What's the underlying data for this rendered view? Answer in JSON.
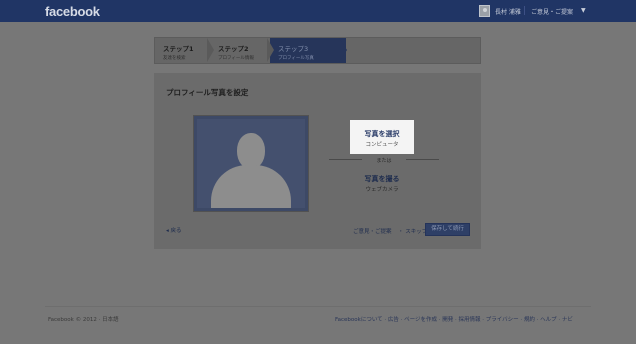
{
  "topbar": {
    "logo": "facebook",
    "user_name": "長村 浦雅",
    "feedback": "ご意見・ご提案",
    "caret": "▼"
  },
  "steps": [
    {
      "title": "ステップ1",
      "subtitle": "友達を検索"
    },
    {
      "title": "ステップ2",
      "subtitle": "プロフィール情報"
    },
    {
      "title": "ステップ3",
      "subtitle": "プロフィール写真"
    }
  ],
  "dialog": {
    "title": "プロフィール写真を設定",
    "choose_photo": "写真を選択",
    "choose_photo_sub": "コンピュータ",
    "or": "または",
    "take_photo": "写真を撮る",
    "take_photo_sub": "ウェブカメラ",
    "back": "◂ 戻る",
    "feedback": "ご意見・ご提案",
    "skip": "・ スキップ",
    "save": "保存して続行"
  },
  "footer": {
    "copyright": "Facebook © 2012 · 日本語",
    "links": "Facebookについて · 広告 · ページを作成 · 開発 · 採用情報 · プライバシー · 規約 · ヘルプ · ナビ"
  },
  "colors": {
    "topbar": "#203565",
    "overlay": "#777777",
    "active_step": "#26355a",
    "save_button": "#2e3f66"
  }
}
